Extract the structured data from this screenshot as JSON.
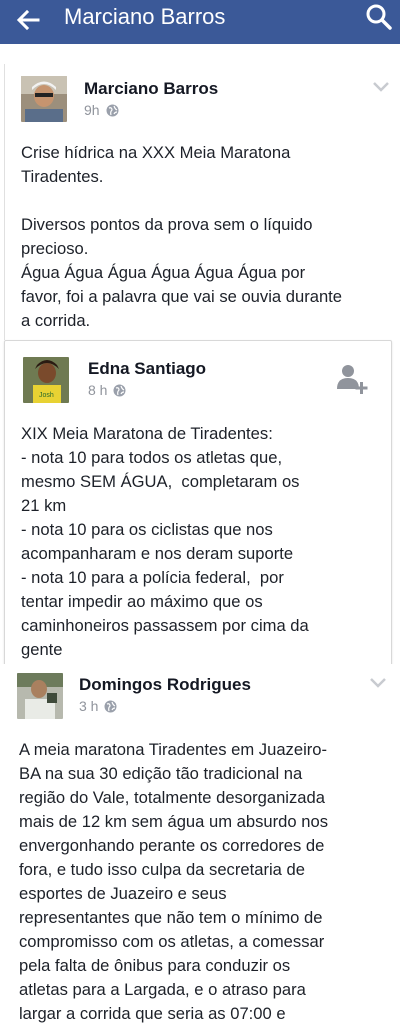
{
  "header": {
    "title": "Marciano Barros",
    "back_icon": "arrow-left-icon",
    "search_icon": "search-icon",
    "color": "#3b5998"
  },
  "posts": [
    {
      "author": "Marciano Barros",
      "time": "9h",
      "text": "Crise hídrica na XXX Meia Maratona\nTiradentes.\n\nDiversos pontos da prova sem o líquido\nprecioso.\nÁgua Água Água Água Água Água por\nfavor, foi a palavra que vai se ouvia durante\na corrida."
    },
    {
      "author": "Edna Santiago",
      "time": "8 h",
      "text": "XIX Meia Maratona de Tiradentes:\n- nota 10 para todos os atletas que,\nmesmo SEM ÁGUA,  completaram os\n21 km\n- nota 10 para os ciclistas que nos\nacompanharam e nos deram suporte\n- nota 10 para a polícia federal,  por\ntentar impedir ao máximo que os\ncaminhoneiros passassem por cima da\ngente"
    },
    {
      "author": "Domingos Rodrigues",
      "time": "3 h",
      "text": "A meia maratona Tiradentes em Juazeiro-\nBA na sua 30 edição tão tradicional na\nregião do Vale, totalmente desorganizada\nmais de 12 km sem água um absurdo nos\nenvergonhando perante os corredores de\nfora, e tudo isso culpa da secretaria de\nesportes de Juazeiro e seus\nrepresentantes que não tem o mínimo de\ncompromisso com os atletas, a comessar\npela falta de ônibus para conduzir os\natletas para a Largada, e o atraso para\nlargar a corrida que seria as 07:00 e"
    }
  ]
}
